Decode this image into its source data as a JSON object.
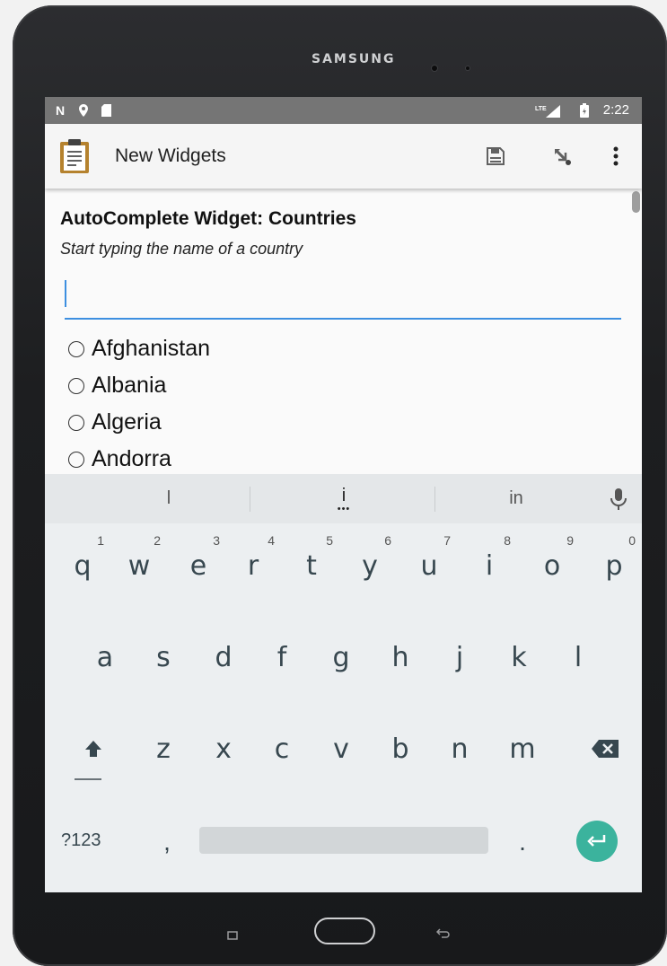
{
  "device": {
    "brand": "SAMSUNG"
  },
  "status_bar": {
    "time": "2:22",
    "icons": [
      "n-icon",
      "location-icon",
      "sd-card-icon",
      "lte-signal-icon",
      "battery-icon"
    ],
    "network_label": "LTE"
  },
  "app_bar": {
    "title": "New Widgets",
    "icons": [
      "clipboard-icon",
      "save-icon",
      "go-to-icon",
      "more-icon"
    ]
  },
  "question": {
    "title": "AutoComplete Widget: Countries",
    "hint": "Start typing the name of a country",
    "input_value": "",
    "options": [
      "Afghanistan",
      "Albania",
      "Algeria",
      "Andorra"
    ]
  },
  "keyboard": {
    "suggestions": [
      "l",
      "i",
      "in"
    ],
    "row1": [
      {
        "k": "q",
        "h": "1"
      },
      {
        "k": "w",
        "h": "2"
      },
      {
        "k": "e",
        "h": "3"
      },
      {
        "k": "r",
        "h": "4"
      },
      {
        "k": "t",
        "h": "5"
      },
      {
        "k": "y",
        "h": "6"
      },
      {
        "k": "u",
        "h": "7"
      },
      {
        "k": "i",
        "h": "8"
      },
      {
        "k": "o",
        "h": "9"
      },
      {
        "k": "p",
        "h": "0"
      }
    ],
    "row2": [
      "a",
      "s",
      "d",
      "f",
      "g",
      "h",
      "j",
      "k",
      "l"
    ],
    "row3": [
      "z",
      "x",
      "c",
      "v",
      "b",
      "n",
      "m"
    ],
    "symbols_label": "?123",
    "comma": ",",
    "period": ".",
    "accent_color": "#3bb39d"
  },
  "colors": {
    "status_bar": "#757575",
    "app_bar": "#f5f5f5",
    "input_underline": "#3d8fe0",
    "keyboard_bg": "#eceff1"
  }
}
